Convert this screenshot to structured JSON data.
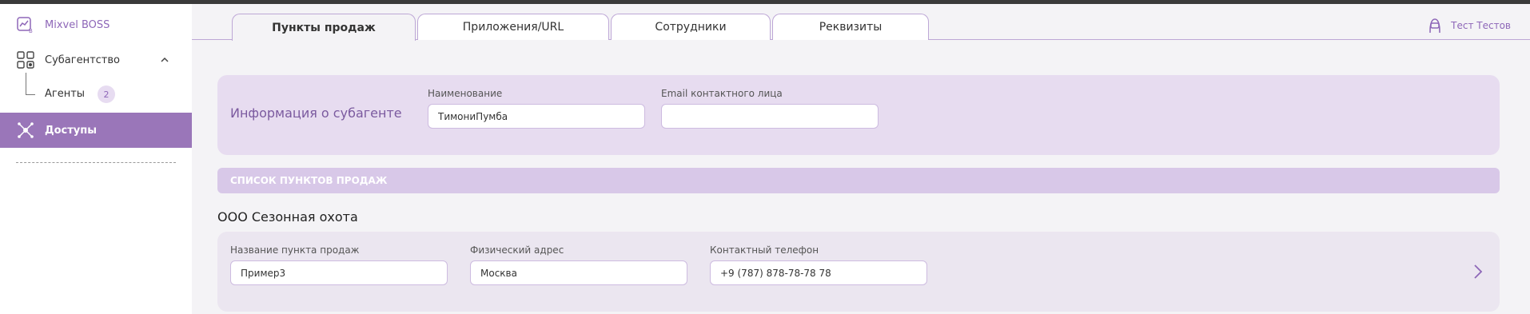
{
  "app": {
    "name": "Mixvel BOSS"
  },
  "sidebar": {
    "group_label": "Субагентство",
    "sub_item_label": "Агенты",
    "sub_item_count": "2",
    "active_item_label": "Доступы"
  },
  "tabs": [
    {
      "label": "Пункты продаж",
      "active": true
    },
    {
      "label": "Приложения/URL",
      "active": false
    },
    {
      "label": "Сотрудники",
      "active": false
    },
    {
      "label": "Реквизиты",
      "active": false
    }
  ],
  "user": {
    "name": "Тест Тестов"
  },
  "info": {
    "title": "Информация о субагенте",
    "name_label": "Наименование",
    "name_value": "ТимониПумба",
    "email_label": "Email контактного лица",
    "email_value": ""
  },
  "list": {
    "header": "СПИСОК ПУНКТОВ ПРОДАЖ",
    "company": "ООО Сезонная охота",
    "pos": {
      "name_label": "Название пункта продаж",
      "name_value": "Пример3",
      "address_label": "Физический адрес",
      "address_value": "Москва",
      "phone_label": "Контактный телефон",
      "phone_value": "+9 (787) 878-78-78 78"
    }
  },
  "colors": {
    "accent": "#8e67b8",
    "active_bg": "#9a76b9",
    "card_bg": "#e7dcf0"
  }
}
